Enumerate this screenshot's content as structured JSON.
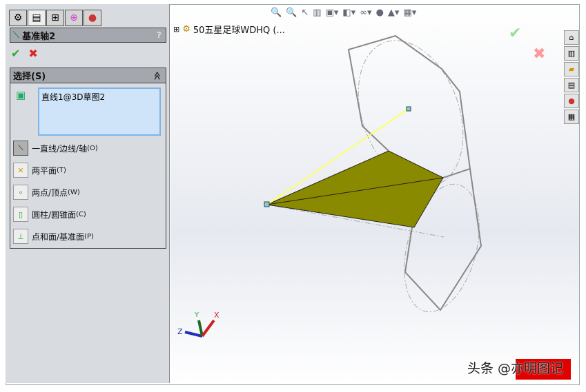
{
  "tabs": [
    {
      "icon": "feature-manager-icon"
    },
    {
      "icon": "property-manager-icon"
    },
    {
      "icon": "configuration-manager-icon"
    },
    {
      "icon": "dimxpert-icon"
    },
    {
      "icon": "display-manager-icon"
    }
  ],
  "feature": {
    "title": "基准轴2",
    "help": "?"
  },
  "actions": {
    "ok": "✔",
    "cancel": "✖"
  },
  "selection": {
    "title": "选择(S)",
    "collapse": "≫",
    "value": "直线1@3D草图2",
    "options": [
      {
        "label": "一直线/边线/轴",
        "key": "(O)",
        "active": true
      },
      {
        "label": "两平面",
        "key": "(T)"
      },
      {
        "label": "两点/顶点",
        "key": "(W)"
      },
      {
        "label": "圆柱/圆锥面",
        "key": "(C)"
      },
      {
        "label": "点和面/基准面",
        "key": "(P)"
      }
    ]
  },
  "tree": {
    "expand": "⊞",
    "label": "50五星足球WDHQ  (..."
  },
  "triad": {
    "x": "X",
    "y": "Y",
    "z": "Z"
  },
  "watermark": "头条 @亦明图记",
  "colors": {
    "face": "#8a8a00",
    "axis": "#ffff66",
    "edge": "#888888"
  }
}
